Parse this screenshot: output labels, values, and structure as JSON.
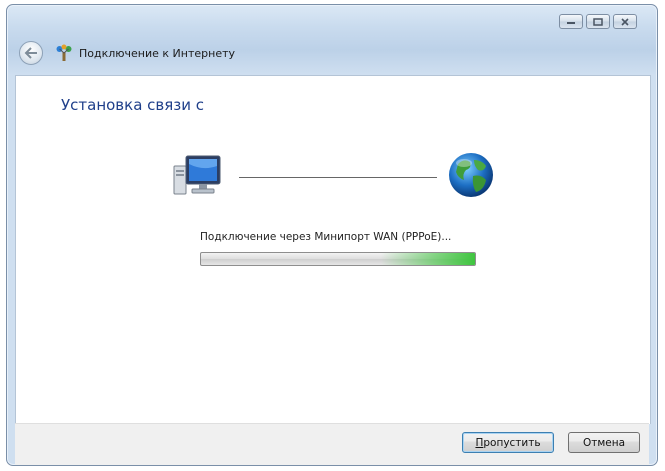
{
  "window": {
    "title": "Подключение к Интернету",
    "caption_buttons": [
      "minimize",
      "maximize",
      "close"
    ]
  },
  "content": {
    "heading": "Установка связи с",
    "status": "Подключение через Минипорт WAN (PPPoE)...",
    "progress_indeterminate": true
  },
  "buttons": {
    "skip_first": "П",
    "skip_rest": "ропустить",
    "cancel": "Отмена"
  },
  "colors": {
    "heading": "#1f3f8a",
    "progress_glow": "#3cc43c",
    "chrome": "#c9dbee"
  },
  "icons": {
    "back": "back-arrow-icon",
    "network": "network-icon",
    "computer": "computer-icon",
    "globe": "globe-icon"
  }
}
